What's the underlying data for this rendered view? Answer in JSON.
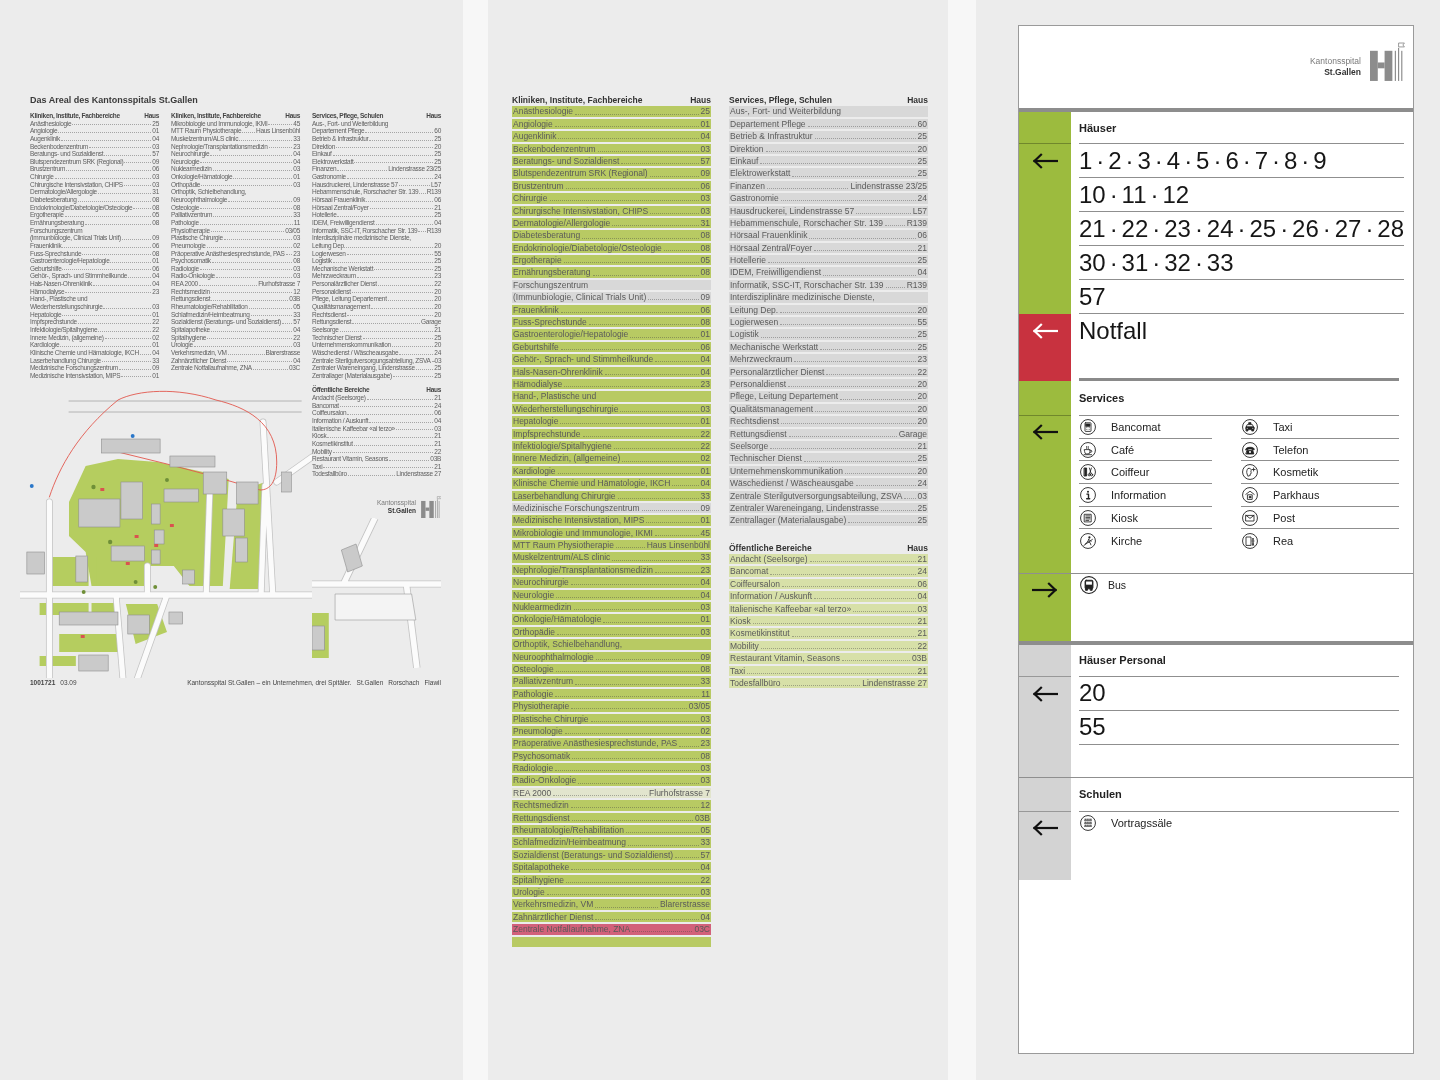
{
  "poster": {
    "title": "Das Areal des Kantonsspitals St.Gallen",
    "columns": [
      {
        "heading": "Kliniken, Institute, Fachbereiche",
        "house_heading": "Haus",
        "rows": [
          {
            "name": "Anästhesiologie",
            "house": "25"
          },
          {
            "name": "Angiologie",
            "house": "01"
          },
          {
            "name": "Augenklinik",
            "house": "04"
          },
          {
            "name": "Beckenbodenzentrum",
            "house": "03"
          },
          {
            "name": "Beratungs- und Sozialdienst",
            "house": "57"
          },
          {
            "name": "Blutspendezentrum SRK (Regional)",
            "house": "09"
          },
          {
            "name": "Brustzentrum",
            "house": "06"
          },
          {
            "name": "Chirurgie",
            "house": "03"
          },
          {
            "name": "Chirurgische Intensivstation, CHIPS",
            "house": "03"
          },
          {
            "name": "Dermatologie/Allergologie",
            "house": "31"
          },
          {
            "name": "Diabetesberatung",
            "house": "08"
          },
          {
            "name": "Endokrinologie/Diabetologie/Osteologie",
            "house": "08"
          },
          {
            "name": "Ergotherapie",
            "house": "05"
          },
          {
            "name": "Ernährungsberatung",
            "house": "08"
          },
          {
            "name": "Forschungszentrum"
          },
          {
            "name": "(Immunbiologie, Clinical Trials Unit)",
            "house": "09"
          },
          {
            "name": "Frauenklinik",
            "house": "06"
          },
          {
            "name": "Fuss-Sprechstunde",
            "house": "08"
          },
          {
            "name": "Gastroenterologie/Hepatologie",
            "house": "01"
          },
          {
            "name": "Geburtshilfe",
            "house": "06"
          },
          {
            "name": "Gehör-, Sprach- und Stimmheilkunde",
            "house": "04"
          },
          {
            "name": "Hals-Nasen-Ohrenklinik",
            "house": "04"
          },
          {
            "name": "Hämodialyse",
            "house": "23"
          },
          {
            "name": "Hand-, Plastische und"
          },
          {
            "name": "Wiederherstellungschirurgie",
            "house": "03"
          },
          {
            "name": "Hepatologie",
            "house": "01"
          },
          {
            "name": "Impfsprechstunde",
            "house": "22"
          },
          {
            "name": "Infektiologie/Spitalhygiene",
            "house": "22"
          },
          {
            "name": "Innere Medizin, (allgemeine)",
            "house": "02"
          },
          {
            "name": "Kardiologie",
            "house": "01"
          },
          {
            "name": "Klinische Chemie und Hämatologie, IKCH",
            "house": "04"
          },
          {
            "name": "Laserbehandlung Chirurgie",
            "house": "33"
          },
          {
            "name": "Medizinische Forschungszentrum",
            "house": "09"
          },
          {
            "name": "Medizinische Intensivstation, MIPS",
            "house": "01"
          }
        ]
      },
      {
        "heading": "Kliniken, Institute, Fachbereiche",
        "house_heading": "Haus",
        "rows": [
          {
            "name": "Mikrobiologie und Immunologie, IKMI",
            "house": "45"
          },
          {
            "name": "MTT Raum Physiotherapie",
            "house": "Haus Linsenbühl"
          },
          {
            "name": "Muskelzentrum/ALS clinic",
            "house": "33"
          },
          {
            "name": "Nephrologie/Transplantationsmedizin",
            "house": "23"
          },
          {
            "name": "Neurochirurgie",
            "house": "04"
          },
          {
            "name": "Neurologie",
            "house": "04"
          },
          {
            "name": "Nuklearmedizin",
            "house": "03"
          },
          {
            "name": "Onkologie/Hämatologie",
            "house": "01"
          },
          {
            "name": "Orthopädie",
            "house": "03"
          },
          {
            "name": "Orthoptik, Schielbehandlung,"
          },
          {
            "name": "Neuroophthalmologie",
            "house": "09"
          },
          {
            "name": "Osteologie",
            "house": "08"
          },
          {
            "name": "Palliativzentrum",
            "house": "33"
          },
          {
            "name": "Pathologie",
            "house": "11"
          },
          {
            "name": "Physiotherapie",
            "house": "03/05"
          },
          {
            "name": "Plastische Chirurgie",
            "house": "03"
          },
          {
            "name": "Pneumologie",
            "house": "02"
          },
          {
            "name": "Präoperative Anästhesiesprechstunde, PAS",
            "house": "23"
          },
          {
            "name": "Psychosomatik",
            "house": "08"
          },
          {
            "name": "Radiologie",
            "house": "03"
          },
          {
            "name": "Radio-Onkologie",
            "house": "03"
          },
          {
            "name": "REA 2000",
            "house": "Flurhofstrasse 7"
          },
          {
            "name": "Rechtsmedizin",
            "house": "12"
          },
          {
            "name": "Rettungsdienst",
            "house": "03B"
          },
          {
            "name": "Rheumatologie/Rehabilitation",
            "house": "05"
          },
          {
            "name": "Schlafmedizin/Heimbeatmung",
            "house": "33"
          },
          {
            "name": "Sozialdienst (Beratungs- und Sozialdienst)",
            "house": "57"
          },
          {
            "name": "Spitalapotheke",
            "house": "04"
          },
          {
            "name": "Spitalhygiene",
            "house": "22"
          },
          {
            "name": "Urologie",
            "house": "03"
          },
          {
            "name": "Verkehrsmedizin, VM",
            "house": "Blarerstrasse"
          },
          {
            "name": "Zahnärztlicher Dienst",
            "house": "04"
          },
          {
            "name": "Zentrale Notfallaufnahme, ZNA",
            "house": "03C"
          }
        ]
      },
      {
        "heading": "Services, Pflege, Schulen",
        "house_heading": "Haus",
        "rows": [
          {
            "name": "Aus-, Fort- und Weiterbildung"
          },
          {
            "name": "Departement Pflege",
            "house": "60"
          },
          {
            "name": "Betrieb & Infrastruktur",
            "house": "25"
          },
          {
            "name": "Direktion",
            "house": "20"
          },
          {
            "name": "Einkauf",
            "house": "25"
          },
          {
            "name": "Elektrowerkstatt",
            "house": "25"
          },
          {
            "name": "Finanzen",
            "house": "Lindenstrasse 23/25"
          },
          {
            "name": "Gastronomie",
            "house": "24"
          },
          {
            "name": "Hausdruckerei, Lindenstrasse 57",
            "house": "L57"
          },
          {
            "name": "Hebammenschule, Rorschacher Str. 139",
            "house": "R139"
          },
          {
            "name": "Hörsaal Frauenklinik",
            "house": "06"
          },
          {
            "name": "Hörsaal Zentral/Foyer",
            "house": "21"
          },
          {
            "name": "Hotellerie",
            "house": "25"
          },
          {
            "name": "IDEM, Freiwilligendienst",
            "house": "04"
          },
          {
            "name": "Informatik, SSC-IT, Rorschacher Str. 139",
            "house": "R139"
          },
          {
            "name": "Interdisziplinäre medizinische Dienste,"
          },
          {
            "name": "Leitung Dep.",
            "house": "20"
          },
          {
            "name": "Logierwesen",
            "house": "55"
          },
          {
            "name": "Logistik",
            "house": "25"
          },
          {
            "name": "Mechanische Werkstatt",
            "house": "25"
          },
          {
            "name": "Mehrzweckraum",
            "house": "23"
          },
          {
            "name": "Personalärztlicher Dienst",
            "house": "22"
          },
          {
            "name": "Personaldienst",
            "house": "20"
          },
          {
            "name": "Pflege, Leitung Departement",
            "house": "20"
          },
          {
            "name": "Qualitätsmanagement",
            "house": "20"
          },
          {
            "name": "Rechtsdienst",
            "house": "20"
          },
          {
            "name": "Rettungsdienst",
            "house": "Garage"
          },
          {
            "name": "Seelsorge",
            "house": "21"
          },
          {
            "name": "Technischer Dienst",
            "house": "25"
          },
          {
            "name": "Unternehmenskommunikation",
            "house": "20"
          },
          {
            "name": "Wäschedienst / Wäscheausgabe",
            "house": "24"
          },
          {
            "name": "Zentrale Sterilgutversorgungsabteilung, ZSVA",
            "house": "03"
          },
          {
            "name": "Zentraler Wareneingang, Lindenstrasse",
            "house": "25"
          },
          {
            "name": "Zentrallager (Materialausgabe)",
            "house": "25"
          }
        ]
      }
    ],
    "public_areas": {
      "heading": "Öffentliche Bereiche",
      "house_heading": "Haus",
      "rows": [
        {
          "name": "Andacht (Seelsorge)",
          "house": "21"
        },
        {
          "name": "Bancomat",
          "house": "24"
        },
        {
          "name": "Coiffeursalon",
          "house": "06"
        },
        {
          "name": "Information / Auskunft",
          "house": "04"
        },
        {
          "name": "Italienische Kaffeebar «al terzo»",
          "house": "03"
        },
        {
          "name": "Kiosk",
          "house": "21"
        },
        {
          "name": "Kosmetikinstitut",
          "house": "21"
        },
        {
          "name": "Mobility",
          "house": "22"
        },
        {
          "name": "Restaurant Vitamin, Seasons",
          "house": "03B"
        },
        {
          "name": "Taxi",
          "house": "21"
        },
        {
          "name": "Todesfallbüro",
          "house": "Lindenstrasse 27"
        }
      ]
    },
    "logo": {
      "name": "Kantonsspital",
      "city": "St.Gallen"
    },
    "footer": {
      "number": "1001721",
      "date": "03.09",
      "tagline": "Kantonsspital St.Gallen – ein Unternehmen, drei Spitäler.",
      "places": [
        "St.Gallen",
        "Rorschach",
        "Flawil"
      ]
    }
  },
  "directory": {
    "columns": [
      {
        "groups": [
          {
            "heading": "Kliniken, Institute, Fachbereiche",
            "house_heading": "Haus",
            "rows": [
              {
                "name": "Anästhesiologie",
                "house": "25",
                "color": "#b8ca63"
              },
              {
                "name": "Angiologie",
                "house": "01",
                "color": "#b8ca63"
              },
              {
                "name": "Augenklinik",
                "house": "04",
                "color": "#b8ca63"
              },
              {
                "name": "Beckenbodenzentrum",
                "house": "03",
                "color": "#b8ca63"
              },
              {
                "name": "Beratungs- und Sozialdienst",
                "house": "57",
                "color": "#b8ca63"
              },
              {
                "name": "Blutspendezentrum SRK (Regional)",
                "house": "09",
                "color": "#b8ca63"
              },
              {
                "name": "Brustzentrum",
                "house": "06",
                "color": "#b8ca63"
              },
              {
                "name": "Chirurgie",
                "house": "03",
                "color": "#b8ca63"
              },
              {
                "name": "Chirurgische Intensivstation, CHIPS",
                "house": "03",
                "color": "#b8ca63"
              },
              {
                "name": "Dermatologie/Allergologie",
                "house": "31",
                "color": "#b8ca63"
              },
              {
                "name": "Diabetesberatung",
                "house": "08",
                "color": "#b8ca63"
              },
              {
                "name": "Endokrinologie/Diabetologie/Osteologie",
                "house": "08",
                "color": "#b8ca63"
              },
              {
                "name": "Ergotherapie",
                "house": "05",
                "color": "#b8ca63"
              },
              {
                "name": "Ernährungsberatung",
                "house": "08",
                "color": "#b8ca63"
              },
              {
                "name": "Forschungszentrum",
                "color": "#d8d8d8"
              },
              {
                "name": "(Immunbiologie, Clinical Trials Unit)",
                "house": "09",
                "color": "#d8d8d8"
              },
              {
                "name": "Frauenklinik",
                "house": "06",
                "color": "#b8ca63"
              },
              {
                "name": "Fuss-Sprechstunde",
                "house": "08",
                "color": "#b8ca63"
              },
              {
                "name": "Gastroenterologie/Hepatologie",
                "house": "01",
                "color": "#b8ca63"
              },
              {
                "name": "Geburtshilfe",
                "house": "06",
                "color": "#b8ca63"
              },
              {
                "name": "Gehör-, Sprach- und Stimmheilkunde",
                "house": "04",
                "color": "#b8ca63"
              },
              {
                "name": "Hals-Nasen-Ohrenklinik",
                "house": "04",
                "color": "#b8ca63"
              },
              {
                "name": "Hämodialyse",
                "house": "23",
                "color": "#b8ca63"
              },
              {
                "name": "Hand-, Plastische und",
                "color": "#b8ca63"
              },
              {
                "name": "Wiederherstellungschirurgie",
                "house": "03",
                "color": "#b8ca63"
              },
              {
                "name": "Hepatologie",
                "house": "01",
                "color": "#b8ca63"
              },
              {
                "name": "Impfsprechstunde",
                "house": "22",
                "color": "#b8ca63"
              },
              {
                "name": "Infektiologie/Spitalhygiene",
                "house": "22",
                "color": "#b8ca63"
              },
              {
                "name": "Innere Medizin, (allgemeine)",
                "house": "02",
                "color": "#b8ca63"
              },
              {
                "name": "Kardiologie",
                "house": "01",
                "color": "#b8ca63"
              },
              {
                "name": "Klinische Chemie und Hämatologie, IKCH",
                "house": "04",
                "color": "#b8ca63"
              },
              {
                "name": "Laserbehandlung Chirurgie",
                "house": "33",
                "color": "#b8ca63"
              },
              {
                "name": "Medizinische Forschungszentrum",
                "house": "09",
                "color": "#d8d8d8"
              },
              {
                "name": "Medizinische Intensivstation, MIPS",
                "house": "01",
                "color": "#b8ca63"
              },
              {
                "name": "Mikrobiologie und Immunologie, IKMI",
                "house": "45",
                "color": "#b8ca63"
              },
              {
                "name": "MTT Raum Physiotherapie",
                "house": "Haus Linsenbühl",
                "color": "#b8ca63"
              },
              {
                "name": "Muskelzentrum/ALS clinic",
                "house": "33",
                "color": "#b8ca63"
              },
              {
                "name": "Nephrologie/Transplantationsmedizin",
                "house": "23",
                "color": "#b8ca63"
              },
              {
                "name": "Neurochirurgie",
                "house": "04",
                "color": "#b8ca63"
              },
              {
                "name": "Neurologie",
                "house": "04",
                "color": "#b8ca63"
              },
              {
                "name": "Nuklearmedizin",
                "house": "03",
                "color": "#b8ca63"
              },
              {
                "name": "Onkologie/Hämatologie",
                "house": "01",
                "color": "#b8ca63"
              },
              {
                "name": "Orthopädie",
                "house": "03",
                "color": "#b8ca63"
              },
              {
                "name": "Orthoptik, Schielbehandlung,",
                "color": "#b8ca63"
              },
              {
                "name": "Neuroophthalmologie",
                "house": "09",
                "color": "#b8ca63"
              },
              {
                "name": "Osteologie",
                "house": "08",
                "color": "#b8ca63"
              },
              {
                "name": "Palliativzentrum",
                "house": "33",
                "color": "#b8ca63"
              },
              {
                "name": "Pathologie",
                "house": "11",
                "color": "#b8ca63"
              },
              {
                "name": "Physiotherapie",
                "house": "03/05",
                "color": "#b8ca63"
              },
              {
                "name": "Plastische Chirurgie",
                "house": "03",
                "color": "#b8ca63"
              },
              {
                "name": "Pneumologie",
                "house": "02",
                "color": "#b8ca63"
              },
              {
                "name": "Präoperative Anästhesiesprechstunde, PAS",
                "house": "23",
                "color": "#b8ca63"
              },
              {
                "name": "Psychosomatik",
                "house": "08",
                "color": "#b8ca63"
              },
              {
                "name": "Radiologie",
                "house": "03",
                "color": "#b8ca63"
              },
              {
                "name": "Radio-Onkologie",
                "house": "03",
                "color": "#b8ca63"
              },
              {
                "name": "REA 2000",
                "house": "Flurhofstrasse 7",
                "color": "#e2e5cd"
              },
              {
                "name": "Rechtsmedizin",
                "house": "12",
                "color": "#b8ca63"
              },
              {
                "name": "Rettungsdienst",
                "house": "03B",
                "color": "#b8ca63"
              },
              {
                "name": "Rheumatologie/Rehabilitation",
                "house": "05",
                "color": "#b8ca63"
              },
              {
                "name": "Schlafmedizin/Heimbeatmung",
                "house": "33",
                "color": "#b8ca63"
              },
              {
                "name": "Sozialdienst (Beratungs- und Sozialdienst)",
                "house": "57",
                "color": "#b8ca63"
              },
              {
                "name": "Spitalapotheke",
                "house": "04",
                "color": "#b8ca63"
              },
              {
                "name": "Spitalhygiene",
                "house": "22",
                "color": "#b8ca63"
              },
              {
                "name": "Urologie",
                "house": "03",
                "color": "#b8ca63"
              },
              {
                "name": "Verkehrsmedizin, VM",
                "house": "Blarerstrasse",
                "color": "#b8ca63"
              },
              {
                "name": "Zahnärztlicher Dienst",
                "house": "04",
                "color": "#b8ca63"
              },
              {
                "name": "Zentrale Notfallaufnahme, ZNA",
                "house": "03C",
                "color": "#d2617a"
              },
              {
                "color": "#b8ca63"
              }
            ]
          }
        ]
      },
      {
        "groups": [
          {
            "heading": "Services, Pflege, Schulen",
            "house_heading": "Haus",
            "rows": [
              {
                "name": "Aus-, Fort- und Weiterbildung",
                "color": "#d8d8d8"
              },
              {
                "name": "Departement Pflege",
                "house": "60",
                "color": "#d8d8d8"
              },
              {
                "name": "Betrieb & Infrastruktur",
                "house": "25",
                "color": "#d8d8d8"
              },
              {
                "name": "Direktion",
                "house": "20",
                "color": "#d8d8d8"
              },
              {
                "name": "Einkauf",
                "house": "25",
                "color": "#d8d8d8"
              },
              {
                "name": "Elektrowerkstatt",
                "house": "25",
                "color": "#d8d8d8"
              },
              {
                "name": "Finanzen",
                "house": "Lindenstrasse 23/25",
                "color": "#d8d8d8"
              },
              {
                "name": "Gastronomie",
                "house": "24",
                "color": "#d8d8d8"
              },
              {
                "name": "Hausdruckerei, Lindenstrasse 57",
                "house": "L57",
                "color": "#d8d8d8"
              },
              {
                "name": "Hebammenschule, Rorschacher Str. 139",
                "house": "R139",
                "color": "#d8d8d8"
              },
              {
                "name": "Hörsaal Frauenklinik",
                "house": "06",
                "color": "#d8d8d8"
              },
              {
                "name": "Hörsaal Zentral/Foyer",
                "house": "21",
                "color": "#d8d8d8"
              },
              {
                "name": "Hotellerie",
                "house": "25",
                "color": "#d8d8d8"
              },
              {
                "name": "IDEM, Freiwilligendienst",
                "house": "04",
                "color": "#d8d8d8"
              },
              {
                "name": "Informatik, SSC-IT, Rorschacher Str. 139",
                "house": "R139",
                "color": "#d8d8d8"
              },
              {
                "name": "Interdisziplinäre medizinische Dienste,",
                "color": "#d8d8d8"
              },
              {
                "name": "Leitung Dep.",
                "house": "20",
                "color": "#d8d8d8"
              },
              {
                "name": "Logierwesen",
                "house": "55",
                "color": "#d8d8d8"
              },
              {
                "name": "Logistik",
                "house": "25",
                "color": "#d8d8d8"
              },
              {
                "name": "Mechanische Werkstatt",
                "house": "25",
                "color": "#d8d8d8"
              },
              {
                "name": "Mehrzweckraum",
                "house": "23",
                "color": "#d8d8d8"
              },
              {
                "name": "Personalärztlicher Dienst",
                "house": "22",
                "color": "#d8d8d8"
              },
              {
                "name": "Personaldienst",
                "house": "20",
                "color": "#d8d8d8"
              },
              {
                "name": "Pflege, Leitung Departement",
                "house": "20",
                "color": "#d8d8d8"
              },
              {
                "name": "Qualitätsmanagement",
                "house": "20",
                "color": "#d8d8d8"
              },
              {
                "name": "Rechtsdienst",
                "house": "20",
                "color": "#d8d8d8"
              },
              {
                "name": "Rettungsdienst",
                "house": "Garage",
                "color": "#d8d8d8"
              },
              {
                "name": "Seelsorge",
                "house": "21",
                "color": "#d8d8d8"
              },
              {
                "name": "Technischer Dienst",
                "house": "25",
                "color": "#d8d8d8"
              },
              {
                "name": "Unternehmenskommunikation",
                "house": "20",
                "color": "#d8d8d8"
              },
              {
                "name": "Wäschedienst / Wäscheausgabe",
                "house": "24",
                "color": "#d8d8d8"
              },
              {
                "name": "Zentrale Sterilgutversorgungsabteilung, ZSVA",
                "house": "03",
                "color": "#d8d8d8"
              },
              {
                "name": "Zentraler Wareneingang, Lindenstrasse",
                "house": "25",
                "color": "#d8d8d8"
              },
              {
                "name": "Zentrallager (Materialausgabe)",
                "house": "25",
                "color": "#d8d8d8"
              }
            ]
          },
          {
            "heading": "Öffentliche Bereiche",
            "house_heading": "Haus",
            "rows": [
              {
                "name": "Andacht (Seelsorge)",
                "house": "21",
                "color": "#d7e0a8"
              },
              {
                "name": "Bancomat",
                "house": "24",
                "color": "#d7e0a8"
              },
              {
                "name": "Coiffeursalon",
                "house": "06",
                "color": "#d7e0a8"
              },
              {
                "name": "Information / Auskunft",
                "house": "04",
                "color": "#d7e0a8"
              },
              {
                "name": "Italienische Kaffeebar «al terzo»",
                "house": "03",
                "color": "#d7e0a8"
              },
              {
                "name": "Kiosk",
                "house": "21",
                "color": "#d7e0a8"
              },
              {
                "name": "Kosmetikinstitut",
                "house": "21",
                "color": "#d7e0a8"
              },
              {
                "name": "Mobility",
                "house": "22",
                "color": "#d7e0a8"
              },
              {
                "name": "Restaurant Vitamin, Seasons",
                "house": "03B",
                "color": "#d7e0a8"
              },
              {
                "name": "Taxi",
                "house": "21",
                "color": "#d7e0a8"
              },
              {
                "name": "Todesfallbüro",
                "house": "Lindenstrasse 27",
                "color": "#d7e0a8"
              }
            ]
          }
        ]
      }
    ]
  },
  "sign": {
    "logo": {
      "name": "Kantonsspital",
      "city": "St.Gallen"
    },
    "sections": [
      {
        "kind": "large",
        "title": "Häuser",
        "color": "#9cbb3e",
        "points_right": false,
        "lines": [
          "1 · 2 · 3 · 4 · 5 · 6 · 7 · 8 · 9",
          "10 · 11 · 12",
          "21 · 22 · 23 · 24 · 25 · 26 · 27 · 28",
          "30 · 31 · 32 · 33",
          "57"
        ]
      },
      {
        "kind": "large",
        "color": "#c8323f",
        "points_right": false,
        "lines": [
          "Notfall"
        ]
      },
      {
        "kind": "services",
        "title": "Services",
        "color": "#9cbb3e",
        "points_right": false,
        "columns": [
          [
            "Bancomat",
            "Café",
            "Coiffeur",
            "Information",
            "Kiosk",
            "Kirche"
          ],
          [
            "Taxi",
            "Telefon",
            "Kosmetik",
            "Parkhaus",
            "Post",
            "Rea"
          ]
        ]
      },
      {
        "kind": "services",
        "color": "#9cbb3e",
        "points_right": true,
        "columns": [
          [
            "Bus"
          ]
        ]
      },
      {
        "kind": "large",
        "title": "Häuser Personal",
        "color": "#d3d3d3",
        "points_right": false,
        "lines": [
          "20",
          "55"
        ]
      },
      {
        "kind": "services",
        "title": "Schulen",
        "color": "#d3d3d3",
        "points_right": false,
        "columns": [
          [
            "Vortragssäle"
          ]
        ]
      }
    ]
  }
}
